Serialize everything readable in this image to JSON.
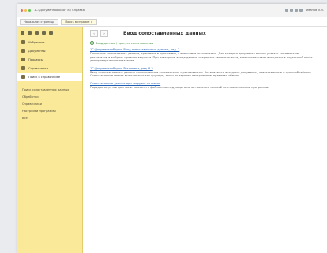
{
  "window": {
    "title": "1С: Документооборот 8 / Справка",
    "user": "Иванов И.И."
  },
  "tabs": [
    "Начальная страница",
    "Поиск в справке ×"
  ],
  "sidebar": {
    "items": [
      {
        "label": "Избранное",
        "active": false
      },
      {
        "label": "Документы",
        "active": false
      },
      {
        "label": "Процессы",
        "active": false
      },
      {
        "label": "Справочники",
        "active": false
      },
      {
        "label": "Поиск в справочнике",
        "active": true
      }
    ],
    "subitems": [
      "Поиск сопоставленных данных",
      "Обработки",
      "Справочники",
      "Настройки программы",
      "Все"
    ]
  },
  "toolbar": {
    "back": "‹",
    "forward": "›"
  },
  "page": {
    "title": "Ввод сопоставленных данных"
  },
  "search_link": "Ввод данных / пропуск сопоставления",
  "results": [
    {
      "title": "1С:Документооборот. Ввод сопоставленных данных, ред. 2",
      "text": "Позволяет сопоставлять данные, хранимые в программе, с внешними источниками. Для каждого документа можно указать соответствие реквизитов и выбрать правило загрузки. При повторном вводе данные сверяются автоматически, а несоответствия выводятся в отдельный отчёт для проверки пользователем."
    },
    {
      "title": "1С:Документооборот. Регламент, ред. 8.2",
      "text": "Ввод сопоставленных данных выполняется в соответствии с регламентом. Указываются исходные документы, ответственные и сроки обработки. Сопоставление может выполняться как вручную, так и по заранее настроенным правилам обмена."
    },
    {
      "title": "Сопоставление данных при загрузке из файла",
      "text": "Порядок загрузки данных из внешнего файла и последующего сопоставления записей со справочниками программы."
    }
  ]
}
